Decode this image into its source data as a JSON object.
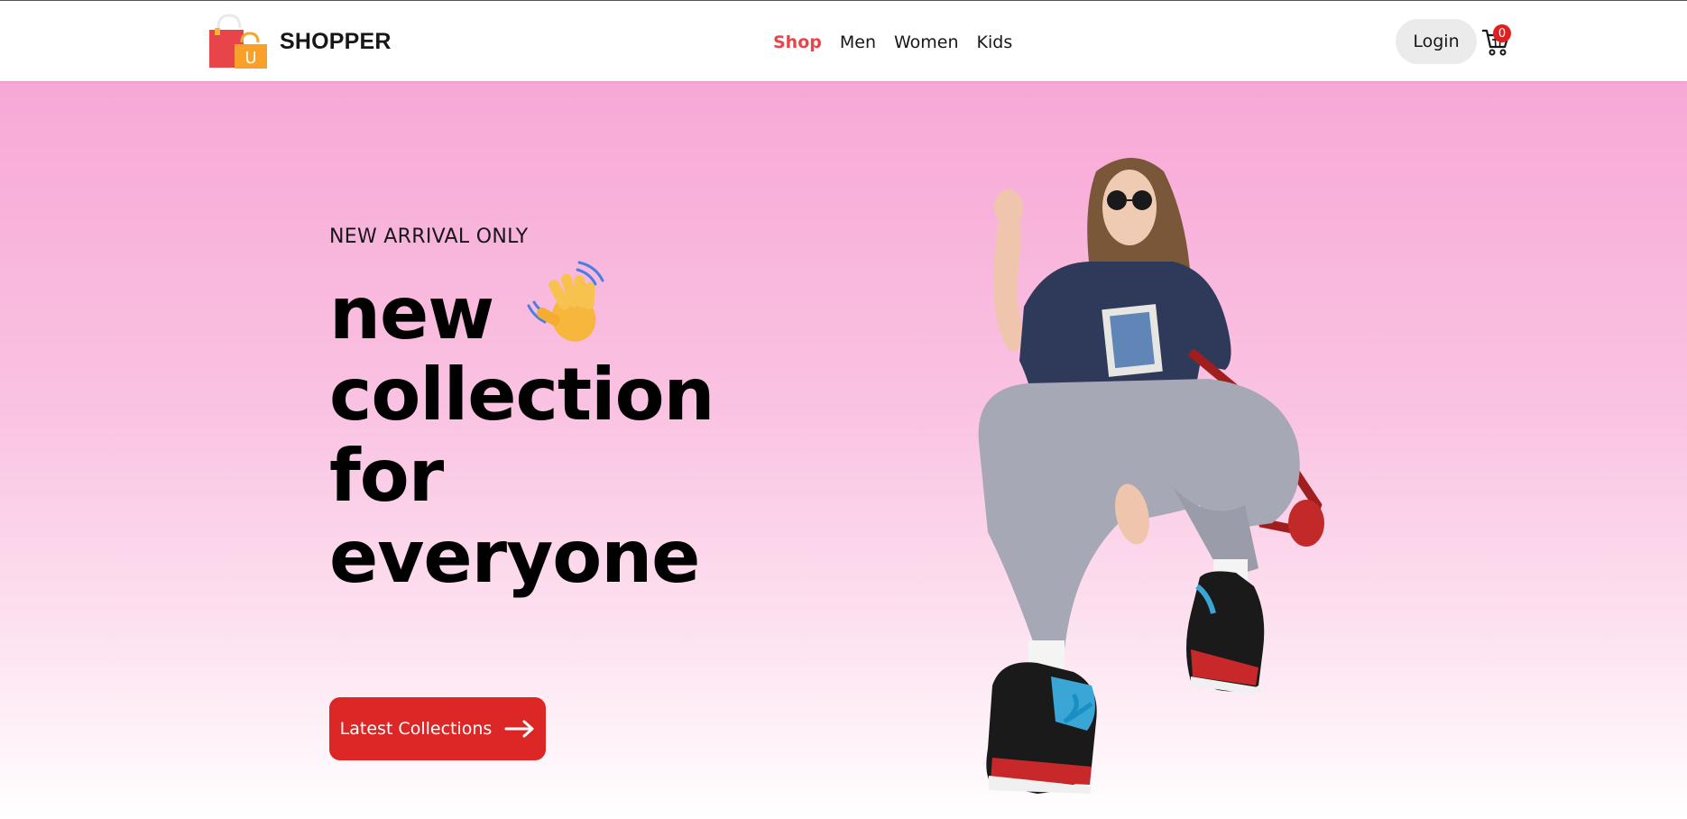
{
  "navbar": {
    "brand": "SHOPPER",
    "menu": [
      {
        "label": "Shop",
        "active": true
      },
      {
        "label": "Men",
        "active": false
      },
      {
        "label": "Women",
        "active": false
      },
      {
        "label": "Kids",
        "active": false
      }
    ],
    "login_label": "Login",
    "cart_count": "0",
    "logo_bag_letter": "U"
  },
  "hero": {
    "eyebrow": "NEW ARRIVAL ONLY",
    "title_lines": [
      "new",
      "collection",
      "for",
      "everyone"
    ],
    "cta_label": "Latest Collections"
  },
  "colors": {
    "accent": "#e8454a",
    "cta": "#dd2626",
    "hero_top": "#f7a8d6",
    "hero_bottom": "#ffffff",
    "login_bg": "#ebebeb"
  },
  "icons": {
    "logo": "shopping-bags-icon",
    "wave": "waving-hand-icon",
    "arrow": "arrow-right-icon",
    "cart": "cart-icon"
  }
}
